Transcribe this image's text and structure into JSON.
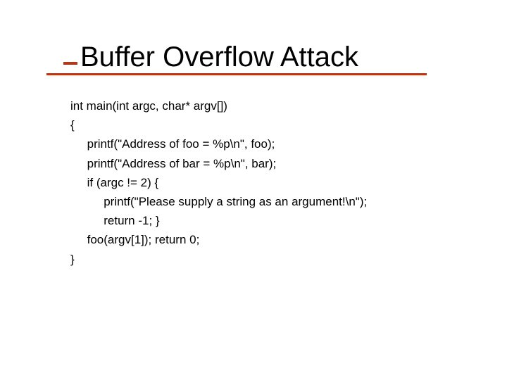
{
  "title": "Buffer Overflow Attack",
  "code": {
    "line1": "int main(int argc, char* argv[])",
    "line2": "{",
    "line3": "     printf(\"Address of foo = %p\\n\", foo);",
    "line4": "     printf(\"Address of bar = %p\\n\", bar);",
    "line5": "     if (argc != 2) {",
    "line6": "          printf(\"Please supply a string as an argument!\\n\");",
    "line7": "          return -1; }",
    "line8": "     foo(argv[1]); return 0;",
    "line9": "}"
  }
}
